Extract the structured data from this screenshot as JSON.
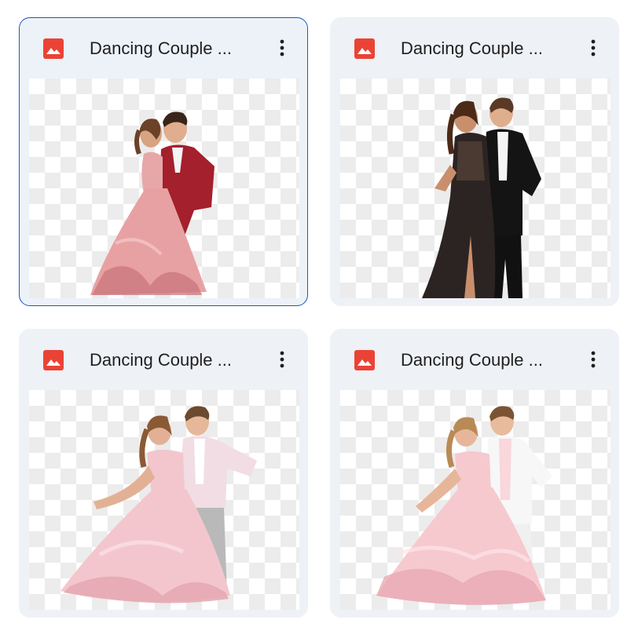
{
  "files": [
    {
      "title": "Dancing Couple ...",
      "selected": true,
      "icon": "image-icon",
      "thumbnail": {
        "dress_color": "#e8a1a3",
        "dress_shade": "#c9767c",
        "jacket_color": "#a3202c",
        "pants_color": "#151515",
        "shirt_color": "#f4f4f4"
      }
    },
    {
      "title": "Dancing Couple ...",
      "selected": false,
      "icon": "image-icon",
      "thumbnail": {
        "dress_color": "#2c2422",
        "dress_shade": "#4a3a32",
        "jacket_color": "#141414",
        "pants_color": "#111111",
        "shirt_color": "#f5f5f5"
      }
    },
    {
      "title": "Dancing Couple ...",
      "selected": false,
      "icon": "image-icon",
      "thumbnail": {
        "dress_color": "#f3c6cd",
        "dress_shade": "#e4a7b1",
        "jacket_color": "#f1dde3",
        "pants_color": "#b9b9b9",
        "shirt_color": "#ffffff"
      }
    },
    {
      "title": "Dancing Couple ...",
      "selected": false,
      "icon": "image-icon",
      "thumbnail": {
        "dress_color": "#f6c9cf",
        "dress_shade": "#e8aab4",
        "jacket_color": "#f7f7f7",
        "pants_color": "#f0f0f0",
        "shirt_color": "#f9d7dc"
      }
    }
  ],
  "colors": {
    "accent_selected_border": "#1a56c8",
    "card_background": "#eef1f6",
    "image_icon_red": "#ea4335",
    "title_text": "#1f1f1f",
    "more_icon": "#1f1f1f"
  }
}
